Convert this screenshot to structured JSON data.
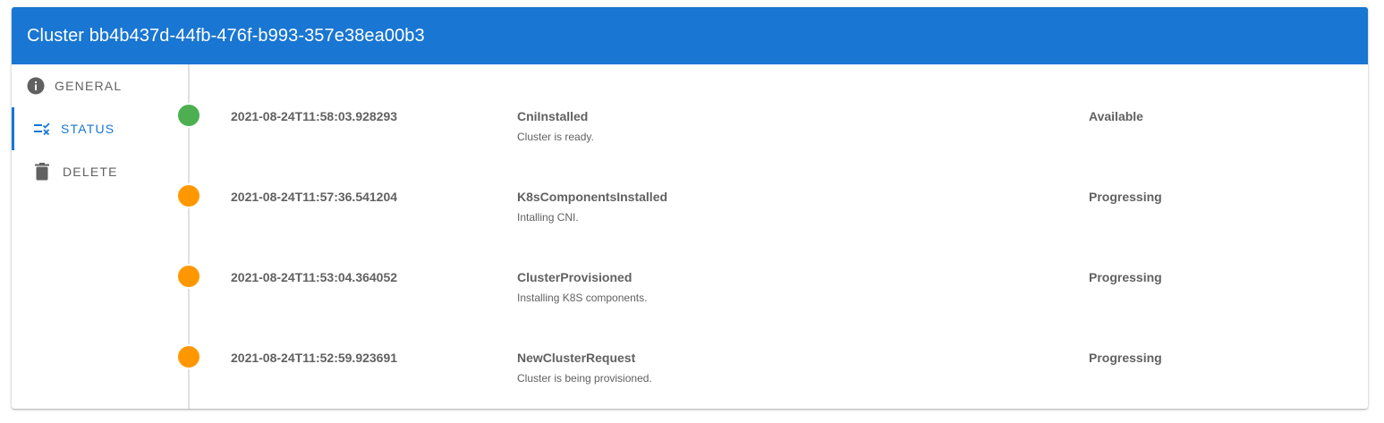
{
  "header": {
    "title": "Cluster bb4b437d-44fb-476f-b993-357e38ea00b3"
  },
  "sidebar": {
    "items": [
      {
        "label": "GENERAL",
        "icon": "info-icon"
      },
      {
        "label": "STATUS",
        "icon": "status-checklist-icon",
        "active": true
      },
      {
        "label": "DELETE",
        "icon": "trash-icon"
      }
    ]
  },
  "colors": {
    "primary": "#1976d2",
    "success": "#4caf50",
    "warning": "#ff9800"
  },
  "events": [
    {
      "timestamp": "2021-08-24T11:58:03.928293",
      "type": "CniInstalled",
      "message": "Cluster is ready.",
      "state": "Available",
      "dot_color": "#4caf50"
    },
    {
      "timestamp": "2021-08-24T11:57:36.541204",
      "type": "K8sComponentsInstalled",
      "message": "Intalling CNI.",
      "state": "Progressing",
      "dot_color": "#ff9800"
    },
    {
      "timestamp": "2021-08-24T11:53:04.364052",
      "type": "ClusterProvisioned",
      "message": "Installing K8S components.",
      "state": "Progressing",
      "dot_color": "#ff9800"
    },
    {
      "timestamp": "2021-08-24T11:52:59.923691",
      "type": "NewClusterRequest",
      "message": "Cluster is being provisioned.",
      "state": "Progressing",
      "dot_color": "#ff9800"
    }
  ]
}
